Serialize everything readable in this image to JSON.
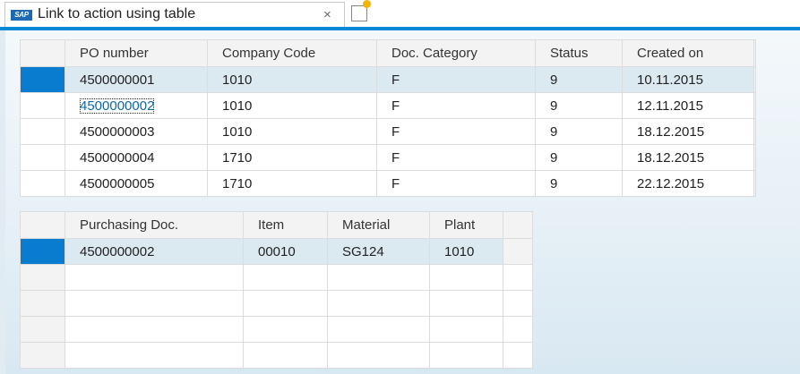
{
  "tab": {
    "logo": "SAP",
    "title": "Link to action using table",
    "close_glyph": "×"
  },
  "colors": {
    "accent": "#0a8ad6",
    "link": "#0b68a6",
    "selected_row": "#dbe9f1",
    "row_selector": "#0a7ccf"
  },
  "po_table": {
    "headers": [
      "PO number",
      "Company Code",
      "Doc. Category",
      "Status",
      "Created on"
    ],
    "rows": [
      {
        "po": "4500000001",
        "company": "1010",
        "category": "F",
        "status": "9",
        "created": "10.11.2015"
      },
      {
        "po": "4500000002",
        "company": "1010",
        "category": "F",
        "status": "9",
        "created": "12.11.2015"
      },
      {
        "po": "4500000003",
        "company": "1010",
        "category": "F",
        "status": "9",
        "created": "18.12.2015"
      },
      {
        "po": "4500000004",
        "company": "1710",
        "category": "F",
        "status": "9",
        "created": "18.12.2015"
      },
      {
        "po": "4500000005",
        "company": "1710",
        "category": "F",
        "status": "9",
        "created": "22.12.2015"
      }
    ]
  },
  "item_table": {
    "headers": [
      "Purchasing Doc.",
      "Item",
      "Material",
      "Plant"
    ],
    "rows": [
      {
        "doc": "4500000002",
        "item": "00010",
        "material": "SG124",
        "plant": "1010"
      }
    ]
  }
}
